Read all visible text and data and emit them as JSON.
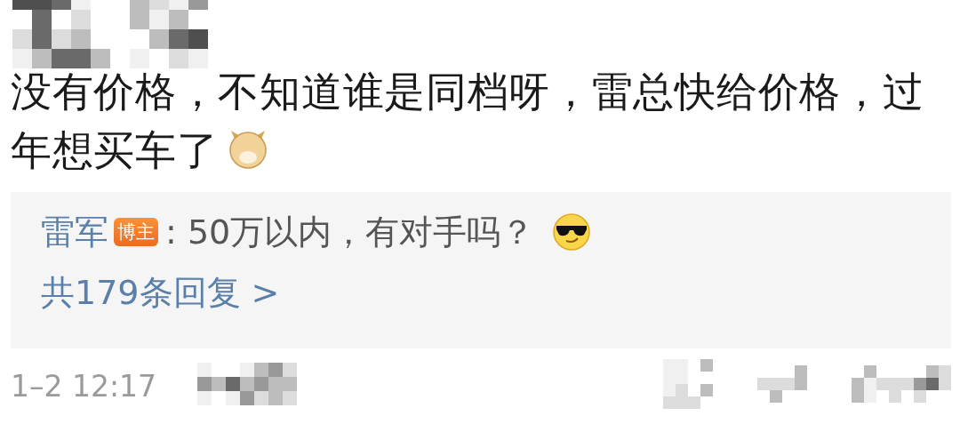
{
  "comment": {
    "text": "没有价格，不知道谁是同档呀，雷总快给价格，过年想买车了"
  },
  "reply_preview": {
    "author": "雷军",
    "badge": "博主",
    "text": ": 50万以内，有对手吗？",
    "reply_count": "共179条回复 >"
  },
  "footer": {
    "timestamp": "1–2 12:17"
  }
}
